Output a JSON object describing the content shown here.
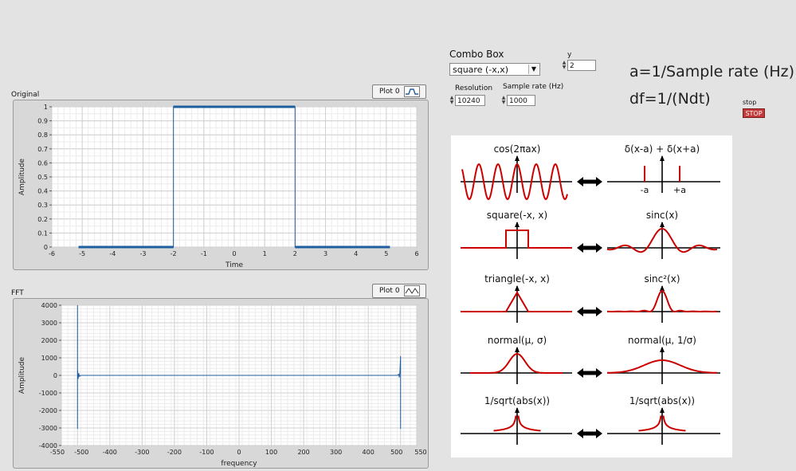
{
  "controls": {
    "combo_label": "Combo Box",
    "combo_value": "square (-x,x)",
    "y_label": "y",
    "y_value": "2",
    "resolution_label": "Resolution",
    "resolution_value": "10240",
    "sample_rate_label": "Sample rate (Hz)",
    "sample_rate_value": "1000",
    "stop_label": "stop",
    "stop_button": "STOP"
  },
  "formulas": {
    "line1": "a=1/Sample rate (Hz)",
    "line2": "df=1/(Ndt)"
  },
  "original_graph": {
    "title": "Original",
    "legend": "Plot 0",
    "xlabel": "Time",
    "ylabel": "Amplitude"
  },
  "fft_graph": {
    "title": "FFT",
    "legend": "Plot 0",
    "xlabel": "frequency",
    "ylabel": "Amplitude"
  },
  "chart_data": [
    {
      "type": "line",
      "title": "Original",
      "xlabel": "Time",
      "ylabel": "Amplitude",
      "xlim": [
        -6,
        6
      ],
      "ylim": [
        0,
        1
      ],
      "xticks": [
        -6,
        -5,
        -4,
        -3,
        -2,
        -1,
        0,
        1,
        2,
        3,
        4,
        5,
        6
      ],
      "yticks": [
        0,
        0.1,
        0.2,
        0.3,
        0.4,
        0.5,
        0.6,
        0.7,
        0.8,
        0.9,
        1
      ],
      "grid": true,
      "series": [
        {
          "name": "Plot 0",
          "x": [
            -5.12,
            -2,
            -2,
            2,
            2,
            5.12
          ],
          "y": [
            0,
            0,
            1,
            1,
            0,
            0
          ]
        }
      ]
    },
    {
      "type": "line",
      "title": "FFT",
      "xlabel": "frequency",
      "ylabel": "Amplitude",
      "xlim": [
        -550,
        550
      ],
      "ylim": [
        -4000,
        4000
      ],
      "xticks": [
        -550,
        -500,
        -400,
        -300,
        -200,
        -100,
        0,
        100,
        200,
        300,
        400,
        500,
        550
      ],
      "yticks": [
        -4000,
        -3000,
        -2000,
        -1000,
        0,
        1000,
        2000,
        3000,
        4000
      ],
      "grid": true,
      "series": [
        {
          "name": "Plot 0",
          "x": [
            -500,
            -500,
            -500,
            -498,
            -496,
            -494,
            -490,
            0,
            490,
            494,
            496,
            498,
            500,
            500,
            500
          ],
          "y": [
            4000,
            -3050,
            400,
            -200,
            120,
            -60,
            0,
            0,
            0,
            60,
            -120,
            200,
            1100,
            -3050,
            0
          ]
        }
      ]
    }
  ],
  "reference_panel": {
    "rows": [
      {
        "left": "cos(2πax)",
        "right": "δ(x-a) + δ(x+a)",
        "right_sub_left": "-a",
        "right_sub_right": "+a"
      },
      {
        "left": "square(-x, x)",
        "right": "sinc(x)"
      },
      {
        "left": "triangle(-x, x)",
        "right": "sinc²(x)"
      },
      {
        "left": "normal(μ, σ)",
        "right": "normal(μ, 1/σ)"
      },
      {
        "left": "1/sqrt(abs(x))",
        "right": "1/sqrt(abs(x))"
      }
    ],
    "curve_color": "#cc0000"
  }
}
